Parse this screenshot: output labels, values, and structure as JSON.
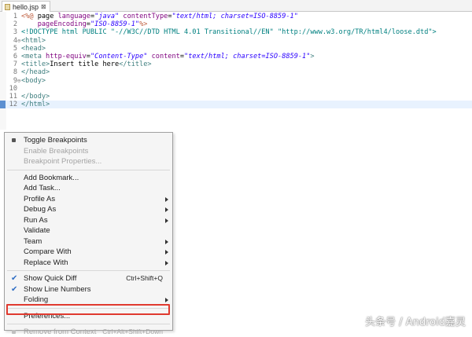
{
  "tab": {
    "title": "hello.jsp",
    "close_glyph": "⊠"
  },
  "editor": {
    "current_line": 12,
    "lines": [
      {
        "num": "1",
        "fold": "",
        "segments": [
          {
            "cls": "t-jsp",
            "text": "<%@"
          },
          {
            "cls": "t-plain",
            "text": " page "
          },
          {
            "cls": "t-attr",
            "text": "language"
          },
          {
            "cls": "t-plain",
            "text": "="
          },
          {
            "cls": "t-str",
            "text": "\"java\""
          },
          {
            "cls": "t-plain",
            "text": " "
          },
          {
            "cls": "t-attr",
            "text": "contentType"
          },
          {
            "cls": "t-plain",
            "text": "="
          },
          {
            "cls": "t-str",
            "text": "\"text/html; charset=ISO-8859-1\""
          }
        ]
      },
      {
        "num": "2",
        "fold": "",
        "segments": [
          {
            "cls": "t-plain",
            "text": "    "
          },
          {
            "cls": "t-attr",
            "text": "pageEncoding"
          },
          {
            "cls": "t-plain",
            "text": "="
          },
          {
            "cls": "t-str",
            "text": "\"ISO-8859-1\""
          },
          {
            "cls": "t-jsp",
            "text": "%>"
          }
        ]
      },
      {
        "num": "3",
        "fold": "",
        "segments": [
          {
            "cls": "t-doc",
            "text": "<!DOCTYPE html PUBLIC \"-//W3C//DTD HTML 4.01 Transitional//EN\" \"http://www.w3.org/TR/html4/loose.dtd\">"
          }
        ]
      },
      {
        "num": "4",
        "fold": "⊖",
        "segments": [
          {
            "cls": "t-tag",
            "text": "<html>"
          }
        ]
      },
      {
        "num": "5",
        "fold": "",
        "segments": [
          {
            "cls": "t-tag",
            "text": "<head>"
          }
        ]
      },
      {
        "num": "6",
        "fold": "",
        "segments": [
          {
            "cls": "t-tag",
            "text": "<meta "
          },
          {
            "cls": "t-attr",
            "text": "http-equiv"
          },
          {
            "cls": "t-plain",
            "text": "="
          },
          {
            "cls": "t-str",
            "text": "\"Content-Type\""
          },
          {
            "cls": "t-plain",
            "text": " "
          },
          {
            "cls": "t-attr",
            "text": "content"
          },
          {
            "cls": "t-plain",
            "text": "="
          },
          {
            "cls": "t-str",
            "text": "\"text/html; charset=ISO-8859-1\""
          },
          {
            "cls": "t-tag",
            "text": ">"
          }
        ]
      },
      {
        "num": "7",
        "fold": "",
        "segments": [
          {
            "cls": "t-tag",
            "text": "<title>"
          },
          {
            "cls": "t-plain",
            "text": "Insert title here"
          },
          {
            "cls": "t-tag",
            "text": "</title>"
          }
        ]
      },
      {
        "num": "8",
        "fold": "",
        "segments": [
          {
            "cls": "t-tag",
            "text": "</head>"
          }
        ]
      },
      {
        "num": "9",
        "fold": "⊖",
        "segments": [
          {
            "cls": "t-tag",
            "text": "<body>"
          }
        ]
      },
      {
        "num": "10",
        "fold": "",
        "segments": []
      },
      {
        "num": "11",
        "fold": "",
        "segments": [
          {
            "cls": "t-tag",
            "text": "</body>"
          }
        ]
      },
      {
        "num": "12",
        "fold": "",
        "segments": [
          {
            "cls": "t-tag",
            "text": "</html>"
          }
        ]
      }
    ]
  },
  "menu": {
    "items": [
      {
        "label": "Toggle Breakpoints",
        "shortcut": "",
        "submenu": false,
        "enabled": true,
        "check": false,
        "dot": true
      },
      {
        "label": "Enable Breakpoints",
        "shortcut": "",
        "submenu": false,
        "enabled": false,
        "check": false,
        "dot": false
      },
      {
        "label": "Breakpoint Properties...",
        "shortcut": "",
        "submenu": false,
        "enabled": false,
        "check": false,
        "dot": false
      },
      {
        "sep": true
      },
      {
        "label": "Add Bookmark...",
        "shortcut": "",
        "submenu": false,
        "enabled": true,
        "check": false,
        "dot": false
      },
      {
        "label": "Add Task...",
        "shortcut": "",
        "submenu": false,
        "enabled": true,
        "check": false,
        "dot": false
      },
      {
        "label": "Profile As",
        "shortcut": "",
        "submenu": true,
        "enabled": true,
        "check": false,
        "dot": false
      },
      {
        "label": "Debug As",
        "shortcut": "",
        "submenu": true,
        "enabled": true,
        "check": false,
        "dot": false
      },
      {
        "label": "Run As",
        "shortcut": "",
        "submenu": true,
        "enabled": true,
        "check": false,
        "dot": false
      },
      {
        "label": "Validate",
        "shortcut": "",
        "submenu": false,
        "enabled": true,
        "check": false,
        "dot": false
      },
      {
        "label": "Team",
        "shortcut": "",
        "submenu": true,
        "enabled": true,
        "check": false,
        "dot": false
      },
      {
        "label": "Compare With",
        "shortcut": "",
        "submenu": true,
        "enabled": true,
        "check": false,
        "dot": false
      },
      {
        "label": "Replace With",
        "shortcut": "",
        "submenu": true,
        "enabled": true,
        "check": false,
        "dot": false
      },
      {
        "sep": true
      },
      {
        "label": "Show Quick Diff",
        "shortcut": "Ctrl+Shift+Q",
        "submenu": false,
        "enabled": true,
        "check": true,
        "dot": false
      },
      {
        "label": "Show Line Numbers",
        "shortcut": "",
        "submenu": false,
        "enabled": true,
        "check": true,
        "dot": false
      },
      {
        "label": "Folding",
        "shortcut": "",
        "submenu": true,
        "enabled": true,
        "check": false,
        "dot": false
      },
      {
        "sep": true
      },
      {
        "label": "Preferences...",
        "shortcut": "",
        "submenu": false,
        "enabled": true,
        "check": false,
        "dot": false,
        "highlighted": true
      },
      {
        "sep": true
      },
      {
        "label": "Remove from Context",
        "shortcut": "Ctrl+Alt+Shift+Down",
        "submenu": false,
        "enabled": false,
        "check": false,
        "dot": true
      }
    ],
    "check_glyph": "✔",
    "highlight_color": "#e03a2f"
  },
  "watermark": {
    "text": "头条号 / Android嘉灵"
  }
}
